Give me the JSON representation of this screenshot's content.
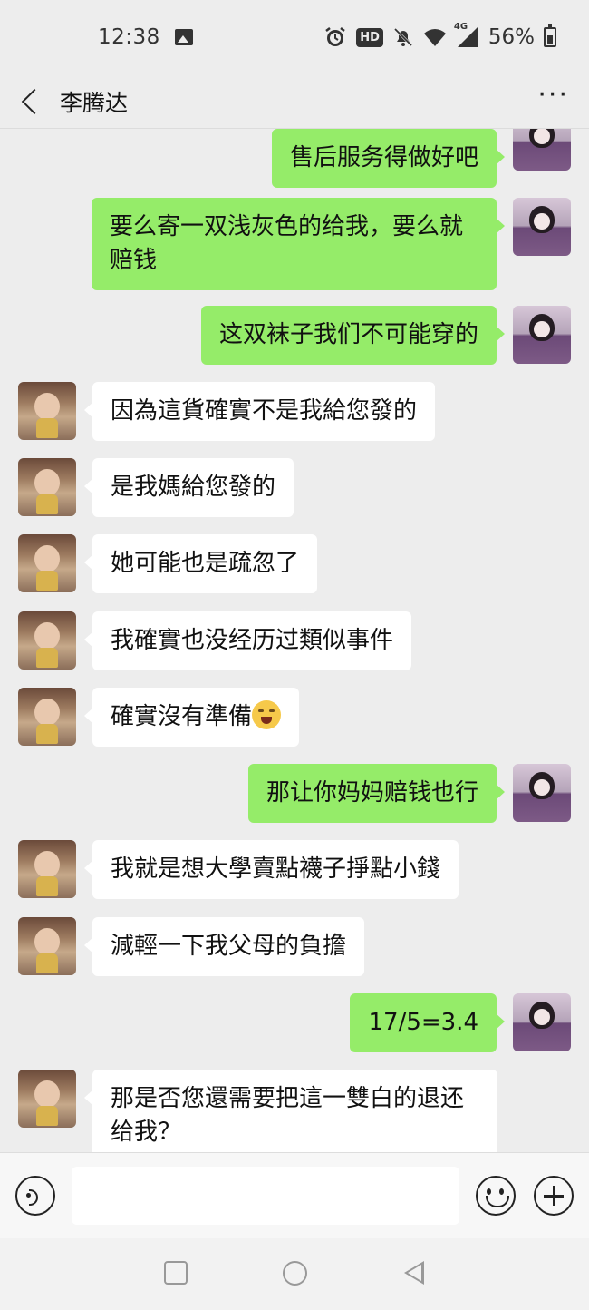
{
  "status_bar": {
    "time": "12:38",
    "network": "4G",
    "hd": "HD",
    "battery": "56%",
    "icons": [
      "image-icon",
      "alarm-icon",
      "hd-icon",
      "mute-icon",
      "wifi-icon",
      "signal-icon",
      "battery-icon"
    ]
  },
  "header": {
    "title": "李腾达",
    "more": "···",
    "icons": [
      "back-arrow-icon",
      "more-icon"
    ]
  },
  "messages": [
    {
      "from": "self",
      "text": "售后服务得做好吧"
    },
    {
      "from": "self",
      "text": "要么寄一双浅灰色的给我，要么就赔钱"
    },
    {
      "from": "self",
      "text": "这双袜子我们不可能穿的"
    },
    {
      "from": "other",
      "text": "因為這貨確實不是我給您發的"
    },
    {
      "from": "other",
      "text": "是我媽給您發的"
    },
    {
      "from": "other",
      "text": "她可能也是疏忽了"
    },
    {
      "from": "other",
      "text": "我確實也没经历过類似事件"
    },
    {
      "from": "other",
      "text": "確實沒有準備",
      "emoji": "crying-laughing-emoji"
    },
    {
      "from": "self",
      "text": "那让你妈妈赔钱也行"
    },
    {
      "from": "other",
      "text": "我就是想大學賣點襪子掙點小錢"
    },
    {
      "from": "other",
      "text": "減輕一下我父母的負擔"
    },
    {
      "from": "self",
      "text": "17/5=3.4"
    },
    {
      "from": "other",
      "text": "那是否您還需要把這一雙白的退还给我？"
    }
  ],
  "input_bar": {
    "placeholder": "",
    "icons": [
      "voice-icon",
      "emoji-icon",
      "plus-icon"
    ]
  },
  "system_nav": {
    "icons": [
      "recent-apps-icon",
      "home-icon",
      "back-icon"
    ]
  },
  "colors": {
    "background": "#ededed",
    "self_bubble": "#95ec69",
    "other_bubble": "#ffffff"
  }
}
